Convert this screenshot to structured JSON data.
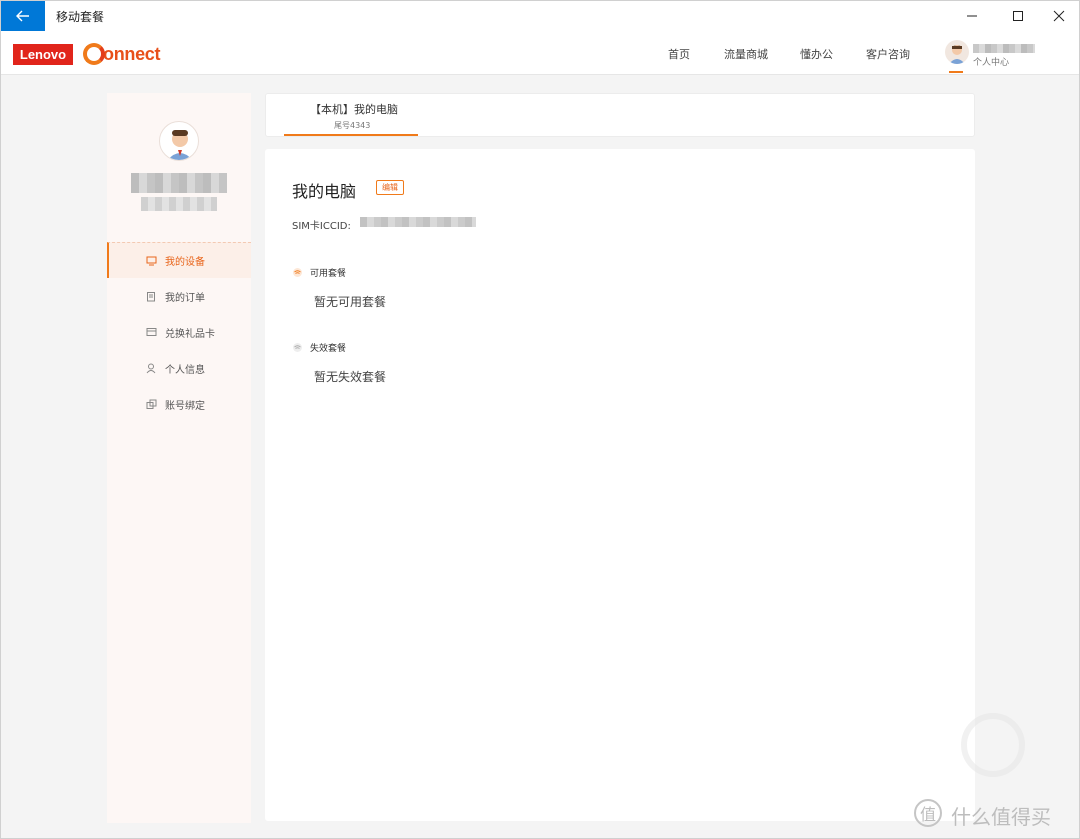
{
  "window": {
    "title": "移动套餐",
    "back_icon": "arrow-left-icon",
    "accent": "#0078d7"
  },
  "header": {
    "logo_lenovo": "Lenovo",
    "logo_connect": "onnect",
    "nav": [
      "首页",
      "流量商城",
      "懂办公",
      "客户咨询"
    ],
    "user_center": "个人中心",
    "brand_color": "#f07a1a"
  },
  "sidebar": {
    "items": [
      {
        "label": "我的设备",
        "icon": "monitor-icon",
        "active": true
      },
      {
        "label": "我的订单",
        "icon": "order-icon",
        "active": false
      },
      {
        "label": "兑换礼品卡",
        "icon": "gift-card-icon",
        "active": false
      },
      {
        "label": "个人信息",
        "icon": "user-icon",
        "active": false
      },
      {
        "label": "账号绑定",
        "icon": "link-account-icon",
        "active": false
      }
    ]
  },
  "tab": {
    "title": "【本机】我的电脑",
    "subtitle": "尾号4343"
  },
  "device": {
    "name": "我的电脑",
    "edit_label": "编辑",
    "iccid_label": "SIM卡ICCID:"
  },
  "packages": {
    "available_title": "可用套餐",
    "available_empty": "暂无可用套餐",
    "expired_title": "失效套餐",
    "expired_empty": "暂无失效套餐"
  },
  "watermark": {
    "text": "什么值得买",
    "logo": "值"
  }
}
